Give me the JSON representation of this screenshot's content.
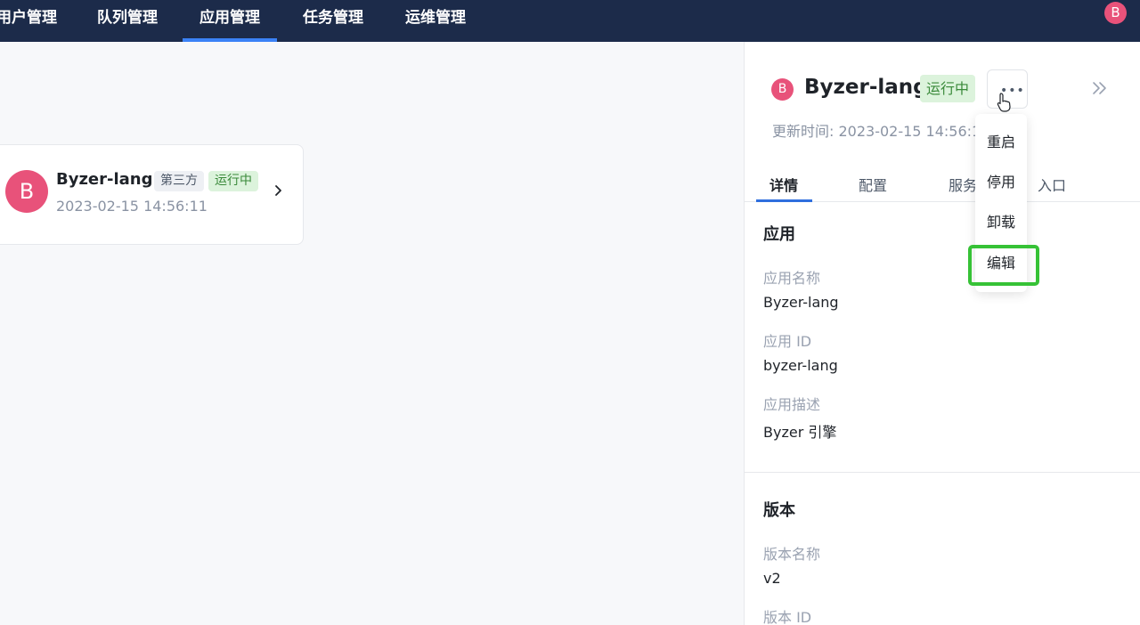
{
  "nav": {
    "items": [
      {
        "label": "用户管理",
        "active": false
      },
      {
        "label": "队列管理",
        "active": false
      },
      {
        "label": "应用管理",
        "active": true
      },
      {
        "label": "任务管理",
        "active": false
      },
      {
        "label": "运维管理",
        "active": false
      }
    ],
    "user_avatar": "B"
  },
  "app_card": {
    "avatar": "B",
    "name": "Byzer-lang",
    "tag_source": "第三方",
    "tag_status": "运行中",
    "time": "2023-02-15 14:56:11"
  },
  "panel": {
    "avatar": "B",
    "title": "Byzer-lang",
    "status": "运行中",
    "update_time": "更新时间: 2023-02-15 14:56:1",
    "tabs": [
      {
        "label": "详情",
        "active": true
      },
      {
        "label": "配置",
        "active": false
      },
      {
        "label": "服务",
        "active": false
      },
      {
        "label": "入口",
        "active": false
      }
    ],
    "sections": {
      "app_title": "应用",
      "app_name_label": "应用名称",
      "app_name_value": "Byzer-lang",
      "app_id_label": "应用 ID",
      "app_id_value": "byzer-lang",
      "app_desc_label": "应用描述",
      "app_desc_value": "Byzer 引擎",
      "version_title": "版本",
      "version_name_label": "版本名称",
      "version_name_value": "v2",
      "version_id_label": "版本 ID"
    }
  },
  "dropdown": {
    "items": [
      "重启",
      "停用",
      "卸载",
      "编辑"
    ],
    "highlighted": "编辑"
  },
  "colors": {
    "nav_bg": "#1c2b4a",
    "nav_active": "#3b82f6",
    "avatar": "#e8527a",
    "status_bg": "#dcf3dc",
    "status_text": "#3a8a3a",
    "highlight": "#36c236"
  }
}
